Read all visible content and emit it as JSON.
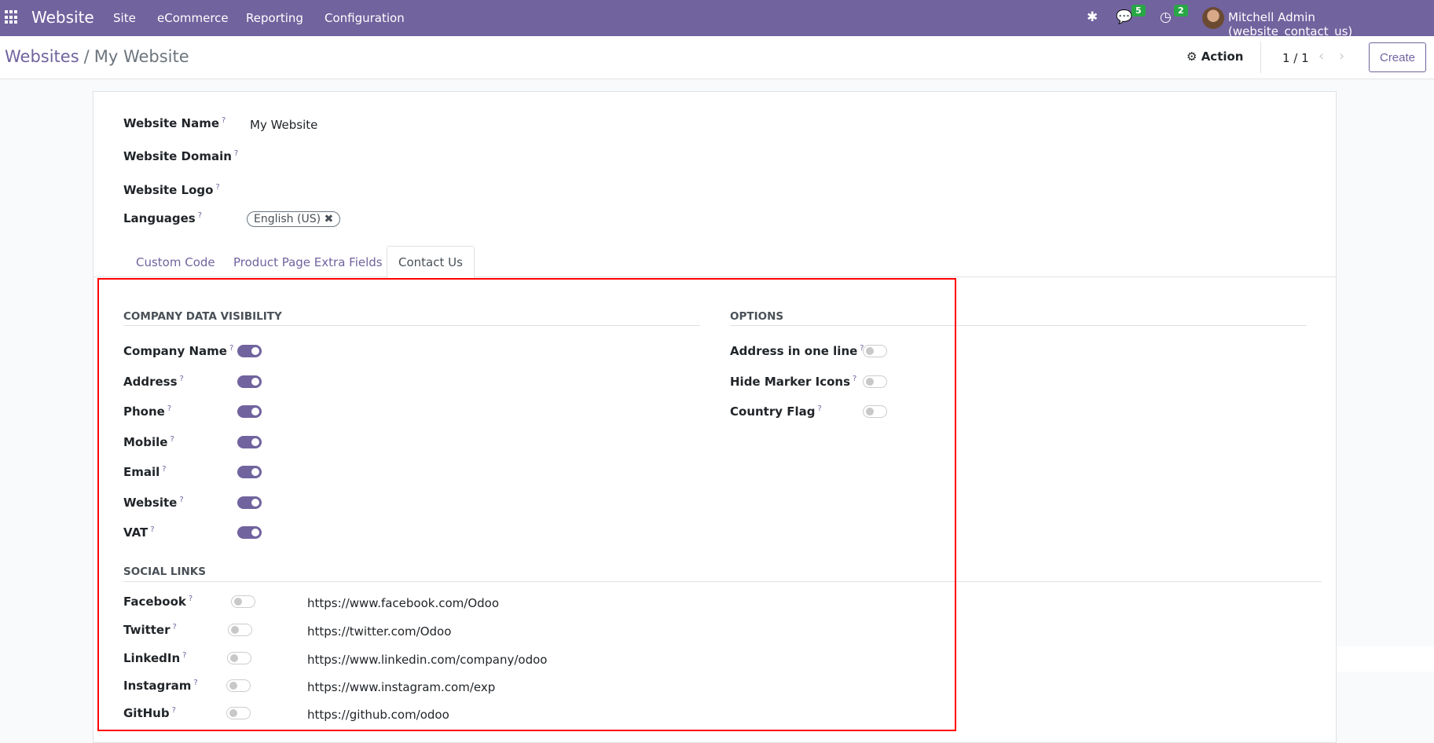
{
  "nav": {
    "brand": "Website",
    "menu": [
      "Site",
      "eCommerce",
      "Reporting",
      "Configuration"
    ],
    "messages_count": "5",
    "activities_count": "2",
    "user": "Mitchell Admin (website_contact_us)"
  },
  "breadcrumb": {
    "parent": "Websites",
    "separator": "/",
    "current": "My Website"
  },
  "control": {
    "action": "Action",
    "pager": "1 / 1",
    "create": "Create"
  },
  "form": {
    "fields": [
      {
        "label": "Website Name",
        "value": "My Website"
      },
      {
        "label": "Website Domain",
        "value": ""
      },
      {
        "label": "Website Logo",
        "value": ""
      },
      {
        "label": "Languages",
        "value": ""
      }
    ],
    "language_tag": "English (US)",
    "help": "?",
    "tabs": [
      "Custom Code",
      "Product Page Extra Fields",
      "Contact Us"
    ],
    "active_tab": "Contact Us",
    "company_section": "COMPANY DATA VISIBILITY",
    "company_fields": [
      {
        "label": "Company Name",
        "on": true
      },
      {
        "label": "Address",
        "on": true
      },
      {
        "label": "Phone",
        "on": true
      },
      {
        "label": "Mobile",
        "on": true
      },
      {
        "label": "Email",
        "on": true
      },
      {
        "label": "Website",
        "on": true
      },
      {
        "label": "VAT",
        "on": true
      }
    ],
    "options_section": "OPTIONS",
    "options": [
      {
        "label": "Address in one line",
        "on": false
      },
      {
        "label": "Hide Marker Icons",
        "on": false
      },
      {
        "label": "Country Flag",
        "on": false
      }
    ],
    "social_section": "SOCIAL LINKS",
    "social": [
      {
        "label": "Facebook",
        "on": false,
        "url": "https://www.facebook.com/Odoo"
      },
      {
        "label": "Twitter",
        "on": false,
        "url": "https://twitter.com/Odoo"
      },
      {
        "label": "LinkedIn",
        "on": false,
        "url": "https://www.linkedin.com/company/odoo"
      },
      {
        "label": "Instagram",
        "on": false,
        "url": "https://www.instagram.com/exp"
      },
      {
        "label": "GitHub",
        "on": false,
        "url": "https://github.com/odoo"
      }
    ]
  },
  "colors": {
    "brand": "#71639e",
    "badge": "#28a745",
    "highlight": "#ff0000"
  }
}
